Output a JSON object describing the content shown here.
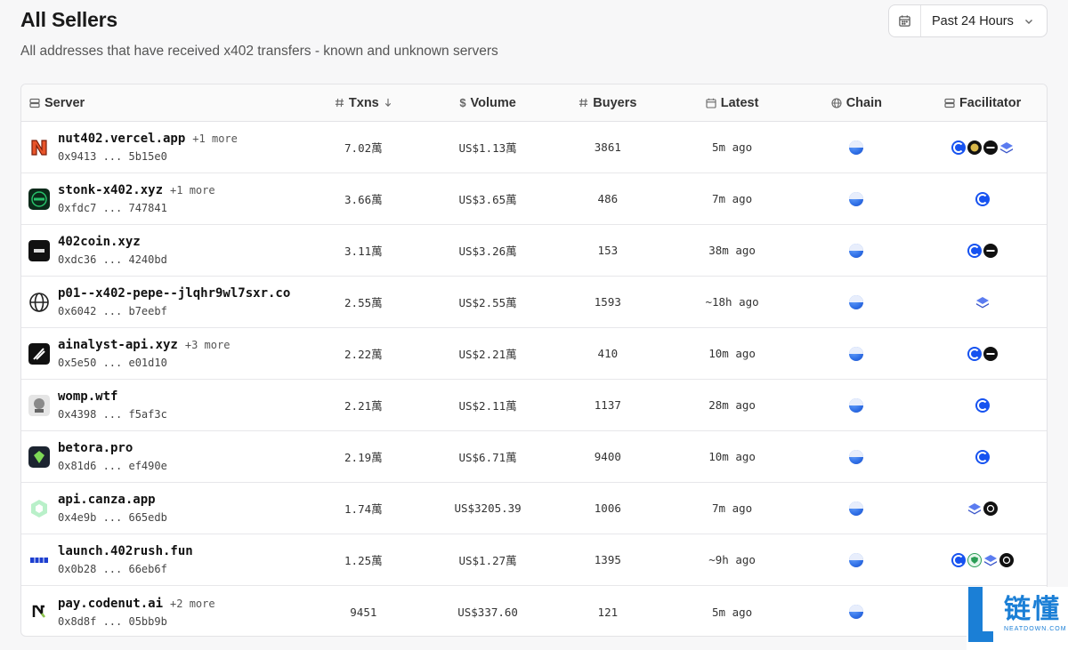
{
  "header": {
    "title": "All Sellers",
    "subtitle": "All addresses that have received x402 transfers - known and unknown servers",
    "range_label": "Past 24 Hours"
  },
  "table": {
    "columns": {
      "server": "Server",
      "txns": "Txns",
      "volume": "Volume",
      "buyers": "Buyers",
      "latest": "Latest",
      "chain": "Chain",
      "facilitator": "Facilitator"
    },
    "rows": [
      {
        "name": "nut402.vercel.app",
        "more": "+1 more",
        "address": "0x9413 ... 5b15e0",
        "txns": "7.02萬",
        "volume": "US$1.13萬",
        "buyers": "3861",
        "latest": "5m ago",
        "facilitators": [
          "coinbase-icon",
          "gold-coin-icon",
          "dark-stripe-icon",
          "layers-icon"
        ]
      },
      {
        "name": "stonk-x402.xyz",
        "more": "+1 more",
        "address": "0xfdc7 ... 747841",
        "txns": "3.66萬",
        "volume": "US$3.65萬",
        "buyers": "486",
        "latest": "7m ago",
        "facilitators": [
          "coinbase-icon"
        ]
      },
      {
        "name": "402coin.xyz",
        "more": "",
        "address": "0xdc36 ... 4240bd",
        "txns": "3.11萬",
        "volume": "US$3.26萬",
        "buyers": "153",
        "latest": "38m ago",
        "facilitators": [
          "coinbase-icon",
          "dark-stripe-icon"
        ]
      },
      {
        "name": "p01--x402-pepe--jlqhr9wl7sxr.co",
        "more": "",
        "address": "0x6042 ... b7eebf",
        "txns": "2.55萬",
        "volume": "US$2.55萬",
        "buyers": "1593",
        "latest": "~18h ago",
        "facilitators": [
          "layers-icon"
        ]
      },
      {
        "name": "ainalyst-api.xyz",
        "more": "+3 more",
        "address": "0x5e50 ... e01d10",
        "txns": "2.22萬",
        "volume": "US$2.21萬",
        "buyers": "410",
        "latest": "10m ago",
        "facilitators": [
          "coinbase-icon",
          "dark-stripe-icon"
        ]
      },
      {
        "name": "womp.wtf",
        "more": "",
        "address": "0x4398 ... f5af3c",
        "txns": "2.21萬",
        "volume": "US$2.11萬",
        "buyers": "1137",
        "latest": "28m ago",
        "facilitators": [
          "coinbase-icon"
        ]
      },
      {
        "name": "betora.pro",
        "more": "",
        "address": "0x81d6 ... ef490e",
        "txns": "2.19萬",
        "volume": "US$6.71萬",
        "buyers": "9400",
        "latest": "10m ago",
        "facilitators": [
          "coinbase-icon"
        ]
      },
      {
        "name": "api.canza.app",
        "more": "",
        "address": "0x4e9b ... 665edb",
        "txns": "1.74萬",
        "volume": "US$3205.39",
        "buyers": "1006",
        "latest": "7m ago",
        "facilitators": [
          "layers-icon",
          "openai-icon"
        ]
      },
      {
        "name": "launch.402rush.fun",
        "more": "",
        "address": "0x0b28 ... 66eb6f",
        "txns": "1.25萬",
        "volume": "US$1.27萬",
        "buyers": "1395",
        "latest": "~9h ago",
        "facilitators": [
          "coinbase-icon",
          "shield-icon",
          "layers-icon",
          "openai-icon"
        ]
      },
      {
        "name": "pay.codenut.ai",
        "more": "+2 more",
        "address": "0x8d8f ... 05bb9b",
        "txns": "9451",
        "volume": "US$337.60",
        "buyers": "121",
        "latest": "5m ago",
        "facilitators": []
      }
    ]
  },
  "watermark": {
    "cn": "链懂",
    "en": "NEATDOWN.COM"
  }
}
